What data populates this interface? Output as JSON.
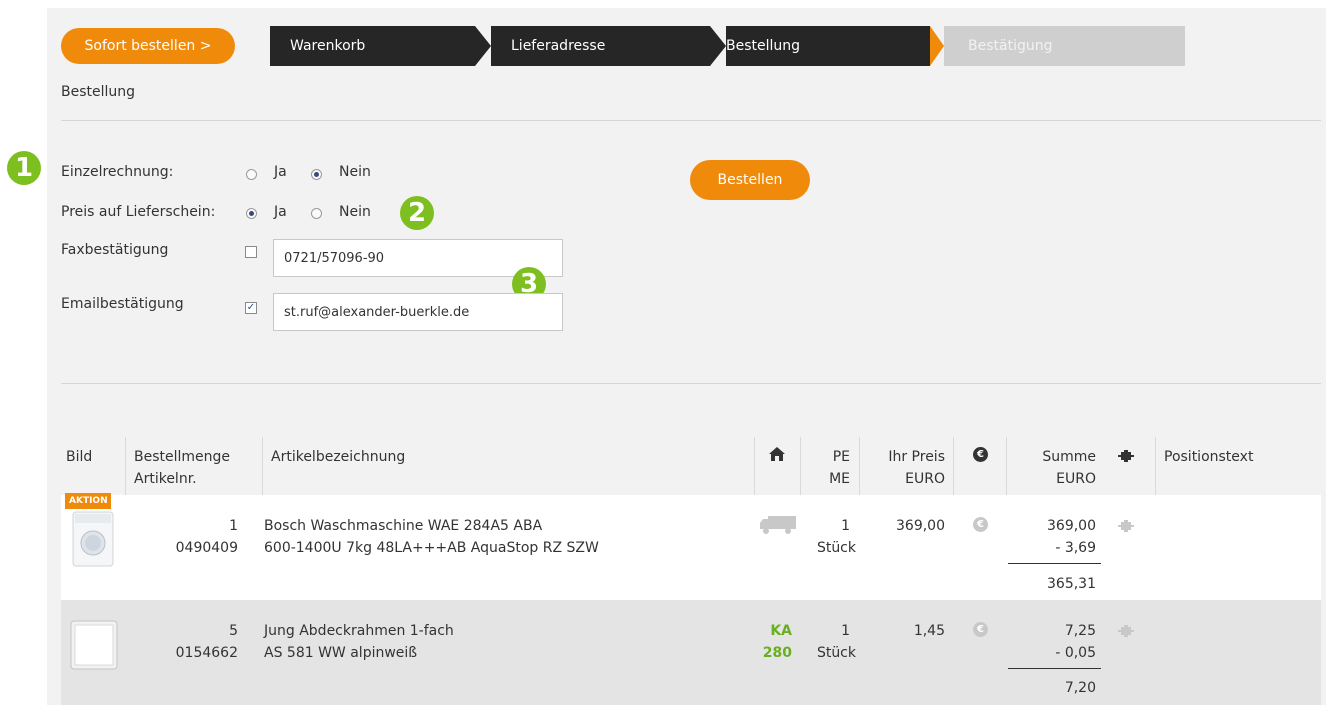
{
  "header": {
    "sofort_label": "Sofort bestellen >",
    "steps": [
      {
        "label": "Warenkorb"
      },
      {
        "label": "Lieferadresse"
      },
      {
        "label": "Bestellung"
      },
      {
        "label": "Bestätigung"
      }
    ],
    "page_title": "Bestellung"
  },
  "form": {
    "einzelrechnung": {
      "label": "Einzelrechnung:",
      "ja": "Ja",
      "nein": "Nein",
      "selected": "Nein"
    },
    "preis_lieferschein": {
      "label": "Preis auf Lieferschein:",
      "ja": "Ja",
      "nein": "Nein",
      "selected": "Ja"
    },
    "fax": {
      "label": "Faxbestätigung",
      "checked": false,
      "value": "0721/57096-90"
    },
    "email": {
      "label": "Emailbestätigung",
      "checked": true,
      "value": "st.ruf@alexander-buerkle.de"
    },
    "order_button": "Bestellen"
  },
  "badges": [
    "1",
    "2",
    "3"
  ],
  "colors": {
    "orange": "#f08a0a",
    "dark": "#262626",
    "green": "#7cbf1e",
    "inactive": "#cfcfcf"
  },
  "table": {
    "headers": {
      "bild": "Bild",
      "menge": "Bestellmenge",
      "artikelnr": "Artikelnr.",
      "bezeichnung": "Artikelbezeichnung",
      "home_icon": "home-icon",
      "pe": "PE",
      "me": "ME",
      "preis": "Ihr Preis",
      "preis_unit": "EURO",
      "euro_icon": "euro-icon",
      "summe": "Summe",
      "summe_unit": "EURO",
      "puzzle_icon": "puzzle-icon",
      "positionstext": "Positionstext"
    },
    "rows": [
      {
        "badge": "AKTION",
        "qty": "1",
        "artnr": "0490409",
        "name1": "Bosch Waschmaschine WAE 284A5 ABA",
        "name2": "600-1400U 7kg 48LA+++AB AquaStop RZ SZW",
        "stock_icon": "truck-icon",
        "pe": "1",
        "me": "Stück",
        "price": "369,00",
        "sum": "369,00",
        "discount": "- 3,69",
        "total": "365,31"
      },
      {
        "qty": "5",
        "artnr": "0154662",
        "name1": "Jung Abdeckrahmen 1-fach",
        "name2": "AS 581 WW alpinweiß",
        "stock1": "KA",
        "stock2": "280",
        "pe": "1",
        "me": "Stück",
        "price": "1,45",
        "sum": "7,25",
        "discount": "- 0,05",
        "total": "7,20"
      }
    ]
  }
}
